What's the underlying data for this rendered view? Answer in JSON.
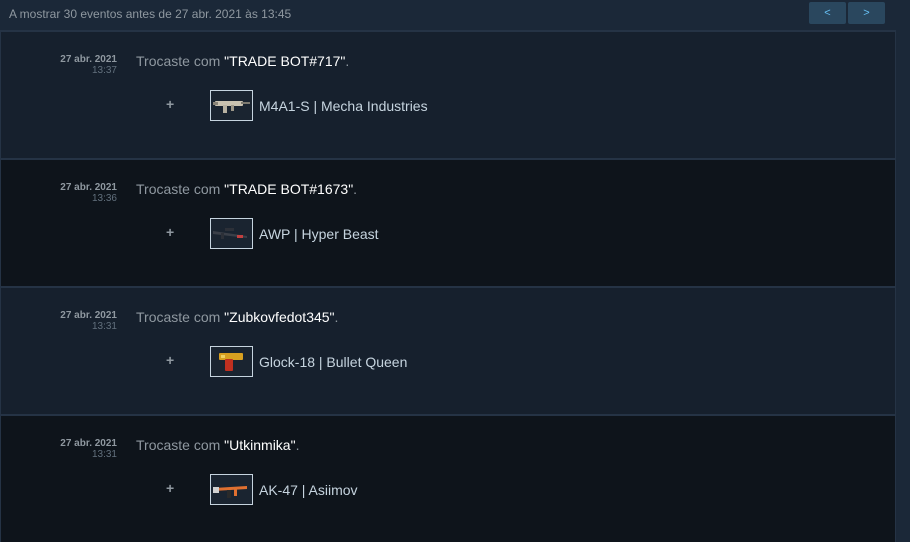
{
  "header": {
    "status_text": "A mostrar 30 eventos antes de 27 abr. 2021 às 13:45",
    "prev_label": "<",
    "next_label": ">"
  },
  "events": [
    {
      "date": "27 abr. 2021",
      "time": "13:37",
      "prefix": "Trocaste com ",
      "partner": "\"TRADE BOT#717\"",
      "suffix": ".",
      "plus": "+",
      "item": "M4A1-S | Mecha Industries",
      "item_icon": "m4a1s-rifle-icon",
      "item_color": "#c9c2b0"
    },
    {
      "date": "27 abr. 2021",
      "time": "13:36",
      "prefix": "Trocaste com ",
      "partner": "\"TRADE BOT#1673\"",
      "suffix": ".",
      "plus": "+",
      "item": "AWP | Hyper Beast",
      "item_icon": "awp-rifle-icon",
      "item_color": "#3a3f48"
    },
    {
      "date": "27 abr. 2021",
      "time": "13:31",
      "prefix": "Trocaste com ",
      "partner": "\"Zubkovfedot345\"",
      "suffix": ".",
      "plus": "+",
      "item": "Glock-18 | Bullet Queen",
      "item_icon": "glock-pistol-icon",
      "item_color": "#d8a020"
    },
    {
      "date": "27 abr. 2021",
      "time": "13:31",
      "prefix": "Trocaste com ",
      "partner": "\"Utkinmika\"",
      "suffix": ".",
      "plus": "+",
      "item": "AK-47 | Asiimov",
      "item_icon": "ak47-rifle-icon",
      "item_color": "#e07030"
    }
  ]
}
